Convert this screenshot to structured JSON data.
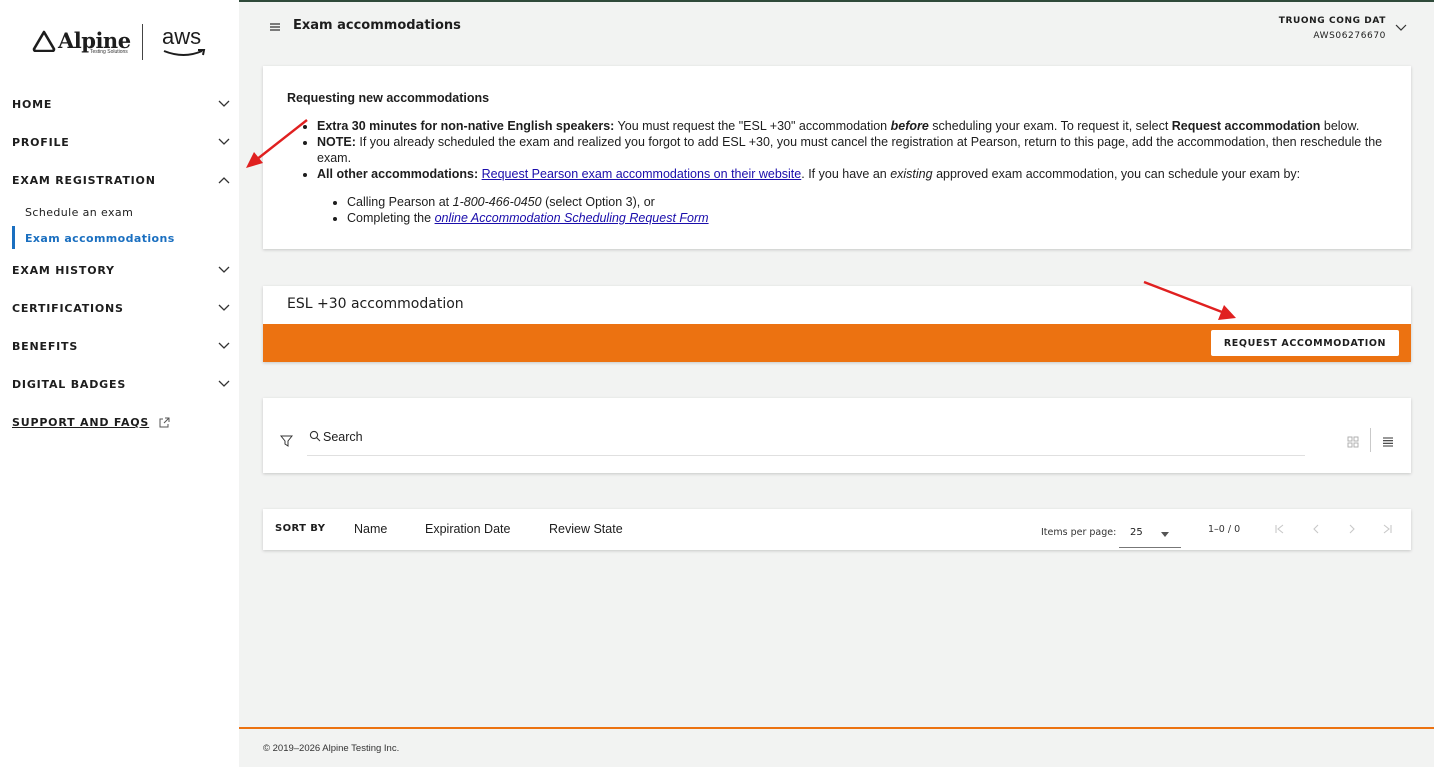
{
  "brand": {
    "name": "Alpine",
    "tagline": "Testing Solutions",
    "partner": "aws"
  },
  "sidebar": {
    "items": [
      {
        "label": "HOME"
      },
      {
        "label": "PROFILE"
      },
      {
        "label": "EXAM REGISTRATION"
      },
      {
        "label": "EXAM HISTORY"
      },
      {
        "label": "CERTIFICATIONS"
      },
      {
        "label": "BENEFITS"
      },
      {
        "label": "DIGITAL BADGES"
      }
    ],
    "sub_items": [
      {
        "label": "Schedule an exam"
      },
      {
        "label": "Exam accommodations"
      }
    ],
    "support": "SUPPORT AND FAQS"
  },
  "header": {
    "title": "Exam accommodations",
    "user_name": "TRUONG CONG DAT",
    "user_id": "AWS06276670"
  },
  "info": {
    "heading": "Requesting new accommodations",
    "b1_bold": "Extra 30 minutes for non-native English speakers:",
    "b1_t1": " You must request the \"ESL +30\" accommodation ",
    "b1_em": "before",
    "b1_t2": " scheduling your exam. To request it, select ",
    "b1_bold2": "Request accommodation",
    "b1_t3": " below.",
    "b2_bold": "NOTE:",
    "b2_text": " If you already scheduled the exam and realized you forgot to add ESL +30, you must cancel the registration at Pearson, return to this page, add the accommodation, then reschedule the exam.",
    "b3_bold": "All other accommodations:",
    "b3_link": "Request Pearson exam accommodations on their website",
    "b3_t1": ". If you have an ",
    "b3_em": "existing",
    "b3_t2": " approved exam accommodation, you can schedule your exam by:",
    "s1_t1": "Calling Pearson at ",
    "s1_em": "1-800-466-0450",
    "s1_t2": " (select Option 3), or",
    "s2_t1": "Completing the ",
    "s2_link": "online Accommodation Scheduling Request Form"
  },
  "esl": {
    "title": "ESL +30 accommodation",
    "button": "REQUEST ACCOMMODATION"
  },
  "search": {
    "placeholder": "Search"
  },
  "sort": {
    "label": "SORT BY",
    "options": [
      "Name",
      "Expiration Date",
      "Review State"
    ],
    "items_per_page_label": "Items per page:",
    "items_per_page": "25",
    "range": "1–0 / 0"
  },
  "footer": {
    "copyright": "© 2019–2026 Alpine Testing Inc."
  },
  "colors": {
    "accent": "#ec7211",
    "link": "#1a6fc0",
    "annotation": "#e02020"
  }
}
